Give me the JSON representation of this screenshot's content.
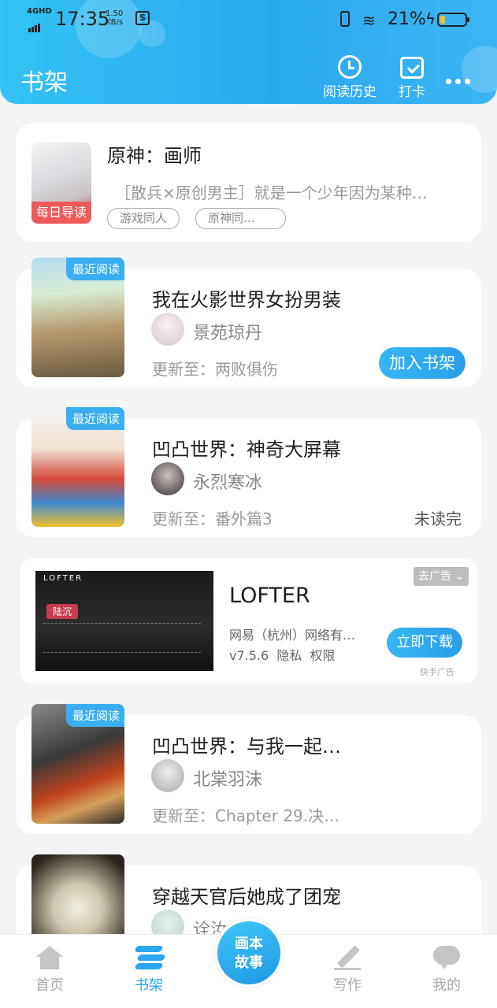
{
  "status_bar": {
    "network": "4GHD",
    "time": "17:35",
    "speed_value": "1.50",
    "speed_unit": "KB/s",
    "battery_pct": "21%",
    "battery_level": 0.21
  },
  "header": {
    "title": "书架",
    "history_label": "阅读历史",
    "checkin_label": "打卡"
  },
  "featured": {
    "title": "原神：画师",
    "desc": "［散兵×原创男主］就是一个少年因为某种…",
    "badge": "每日导读",
    "tags": [
      "游戏同人",
      "原神同…"
    ]
  },
  "books": [
    {
      "title": "我在火影世界女扮男装",
      "author": "景苑琼丹",
      "update": "更新至：两败俱伤",
      "tag": "最近阅读",
      "action": "加入书架",
      "status": ""
    },
    {
      "title": "凹凸世界：神奇大屏幕",
      "author": "永烈寒冰",
      "update": "更新至：番外篇3",
      "tag": "最近阅读",
      "action": "",
      "status": "未读完"
    },
    {
      "title": "凹凸世界：与我一起…",
      "author": "北棠羽沫",
      "update": "更新至：Chapter 29.决…",
      "tag": "最近阅读",
      "action": "",
      "status": ""
    },
    {
      "title": "穿越天官后她成了团宠",
      "author": "诠汝…",
      "update": "",
      "tag": "",
      "action": "",
      "status": ""
    }
  ],
  "ad": {
    "app_name": "LOFTER",
    "company": "网易（杭州）网络有…",
    "meta": "v7.5.6  隐私  权限",
    "remove_ad": "去广告",
    "download": "立即下载",
    "source": "快手广告",
    "banner_brand": "LOFTER",
    "banner_tag": "陆沉"
  },
  "tabs": {
    "home": "首页",
    "shelf": "书架",
    "center_line1": "画本",
    "center_line2": "故事",
    "write": "写作",
    "mine": "我的"
  },
  "colors": {
    "accent": "#2aa5ee",
    "header_gradient_start": "#34c3f5",
    "badge_red": "#ee5a5a"
  }
}
